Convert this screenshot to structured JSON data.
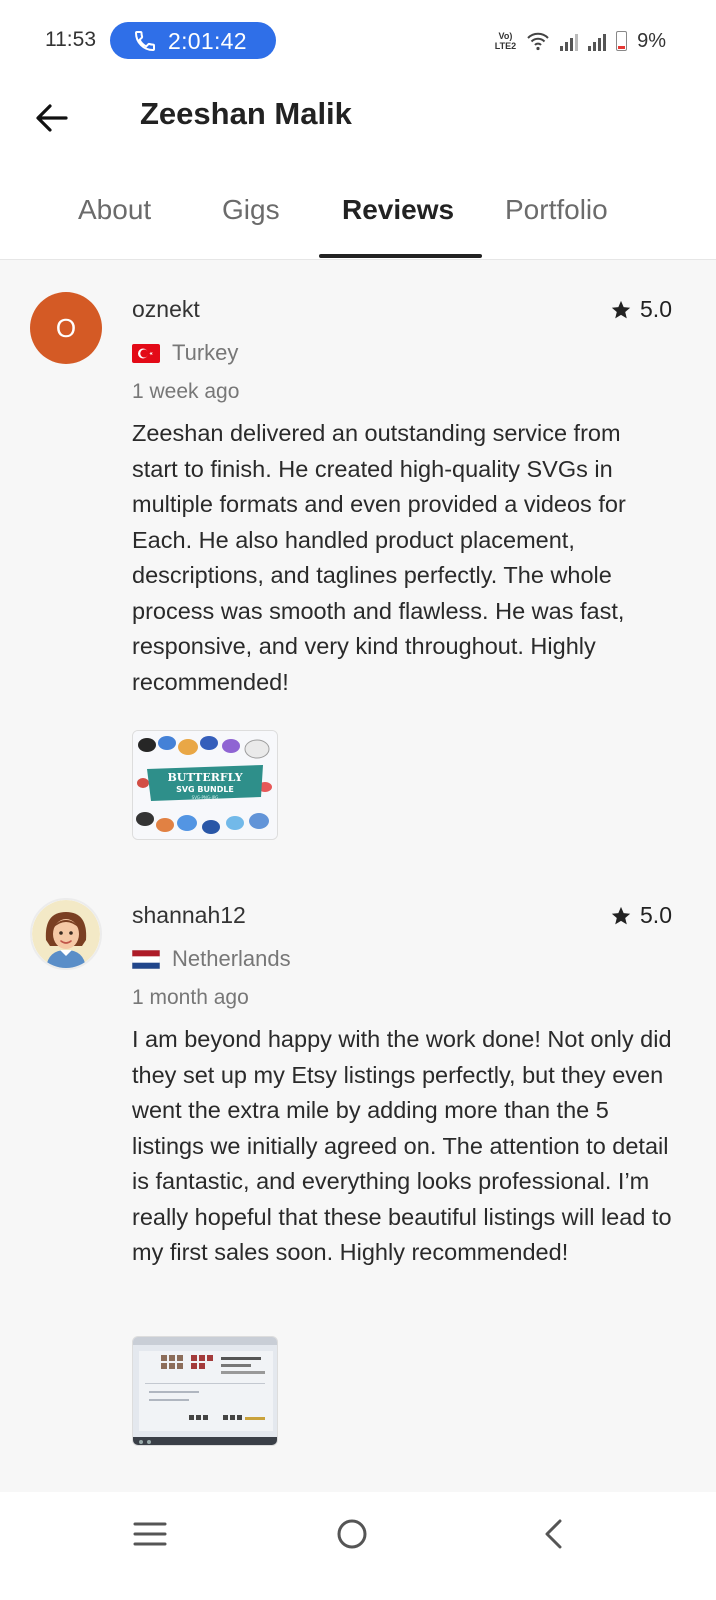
{
  "status_bar": {
    "time": "11:53",
    "call_timer": "2:01:42",
    "volte_label": "Vo) LTE2",
    "battery_percent": "9%",
    "accent_color": "#2f6fe8"
  },
  "header": {
    "title": "Zeeshan Malik",
    "back_icon": "arrow-left-icon"
  },
  "tabs": [
    {
      "label": "About",
      "active": false
    },
    {
      "label": "Gigs",
      "active": false
    },
    {
      "label": "Reviews",
      "active": true
    },
    {
      "label": "Portfolio",
      "active": false
    }
  ],
  "reviews": [
    {
      "avatar_letter": "O",
      "avatar_color": "#d45a25",
      "name": "oznekt",
      "rating": "5.0",
      "country": "Turkey",
      "time_ago": "1 week ago",
      "text": "Zeeshan delivered an outstanding service from start to finish. He created high-quality SVGs in multiple formats and even provided a videos for Each. He also handled product placement, descriptions, and taglines perfectly. The whole process was smooth and flawless. He was fast, responsive, and very kind throughout. Highly recommended!",
      "thumbnail": {
        "title": "BUTTERFLY",
        "subtitle": "SVG BUNDLE",
        "formats": "SVG-PNG-JPG"
      }
    },
    {
      "avatar_letter": "",
      "name": "shannah12",
      "rating": "5.0",
      "country": "Netherlands",
      "time_ago": "1 month ago",
      "text": "I am beyond happy with the work done! Not only did they set up my Etsy listings perfectly, but they even went the extra mile by adding more than the 5 listings we initially agreed on. The attention to detail is fantastic, and everything looks professional. I’m really hopeful that these beautiful listings will lead to my first sales soon. Highly recommended!"
    }
  ],
  "nav": {
    "recents_icon": "menu-lines-icon",
    "home_icon": "home-circle-icon",
    "back_icon": "chevron-left-icon"
  }
}
